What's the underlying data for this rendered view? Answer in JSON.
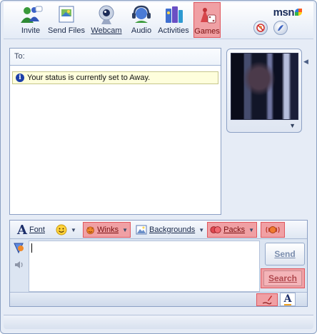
{
  "window": {
    "minimize_glyph": "_",
    "maximize_glyph": "□",
    "close_glyph": "✕"
  },
  "toolbar": {
    "items": [
      {
        "label": "Invite",
        "icon": "invite-people-icon"
      },
      {
        "label": "Send Files",
        "icon": "send-files-icon"
      },
      {
        "label": "Webcam",
        "icon": "webcam-icon"
      },
      {
        "label": "Audio",
        "icon": "audio-headset-icon"
      },
      {
        "label": "Activities",
        "icon": "activities-icon"
      },
      {
        "label": "Games",
        "icon": "games-icon"
      }
    ],
    "logo_text": "msn",
    "block_icon": "block-contact-icon",
    "display_pic_icon": "display-picture-icon"
  },
  "conversation": {
    "to_label": "To:",
    "status_message": "Your status is currently set to Away."
  },
  "webcam_panel": {
    "menu_glyph": "▼",
    "toggle_glyph": "◀"
  },
  "format_bar": {
    "font_letter": "A",
    "font_label": "Font",
    "emoticon_icon": "smiley-icon",
    "winks_label": "Winks",
    "backgrounds_label": "Backgrounds",
    "packs_label": "Packs",
    "nudge_icon": "nudge-icon",
    "dropdown_glyph": "▼"
  },
  "compose": {
    "send_label": "Send",
    "search_label": "Search",
    "text_mode_letter": "A",
    "ink_icon": "handwriting-pen-icon"
  },
  "accent_colors": {
    "highlight_fill": "#f0a0a4",
    "highlight_border": "#e0575e"
  }
}
